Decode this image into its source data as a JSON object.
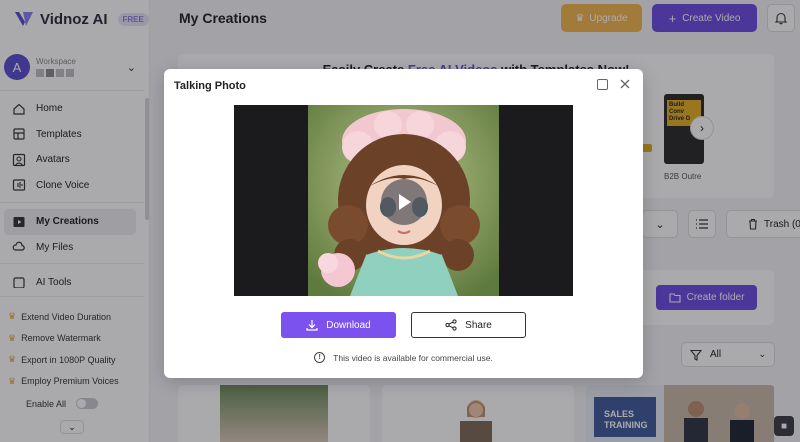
{
  "app": {
    "name": "Vidnoz AI",
    "plan_badge": "FREE"
  },
  "workspace": {
    "label": "Workspace",
    "avatar_letter": "A"
  },
  "sidebar": {
    "items": [
      {
        "label": "Home",
        "icon": "home-icon"
      },
      {
        "label": "Templates",
        "icon": "templates-icon"
      },
      {
        "label": "Avatars",
        "icon": "avatars-icon"
      },
      {
        "label": "Clone Voice",
        "icon": "clone-voice-icon"
      },
      {
        "label": "My Creations",
        "icon": "play-square-icon",
        "active": true
      },
      {
        "label": "My Files",
        "icon": "cloud-icon"
      },
      {
        "label": "AI Tools",
        "icon": "ai-tools-icon"
      }
    ],
    "upsell": [
      {
        "label": "Extend Video Duration"
      },
      {
        "label": "Remove Watermark"
      },
      {
        "label": "Export in 1080P Quality"
      },
      {
        "label": "Employ Premium Voices"
      }
    ],
    "enable_all_label": "Enable All"
  },
  "header": {
    "title": "My Creations",
    "upgrade_label": "Upgrade",
    "create_video_label": "Create Video"
  },
  "banner": {
    "title_prefix": "Easily Create ",
    "title_accent": "Free AI Videos",
    "title_suffix": " with Templates Now!",
    "template_caption": "B2B Outre",
    "template_card_text": "Build Conv Drive G"
  },
  "toolbar": {
    "trash_label": "Trash (0)",
    "create_folder_label": "Create folder",
    "filter_value": "All"
  },
  "thumbnails": {
    "third_card_text_line1": "SALES",
    "third_card_text_line2": "TRAINING"
  },
  "modal": {
    "title": "Talking Photo",
    "download_label": "Download",
    "share_label": "Share",
    "note": "This video is available for commercial use."
  },
  "colors": {
    "accent": "#6a4be0",
    "download_button": "#7b52ee",
    "upgrade_button": "#f2b54a",
    "crown": "#e8a23a"
  }
}
